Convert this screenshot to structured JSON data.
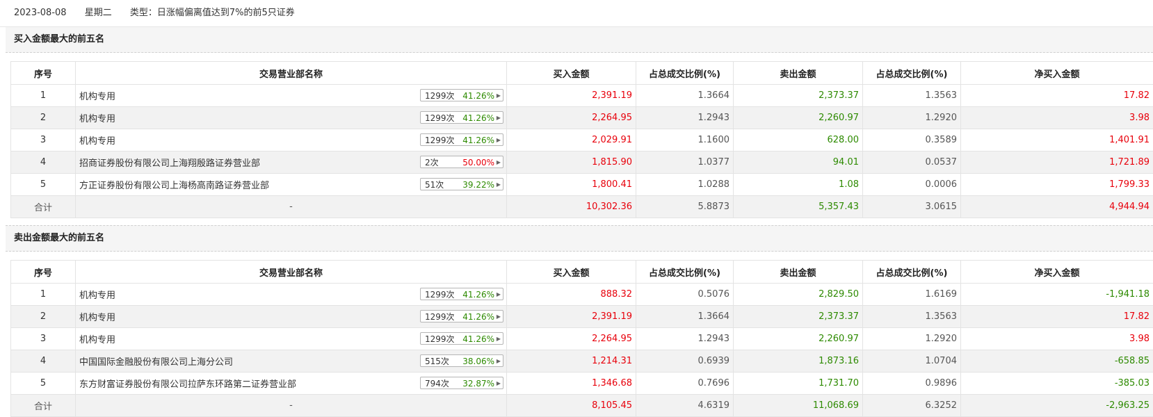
{
  "info": {
    "date": "2023-08-08",
    "weekday": "星期二",
    "type": "类型：日涨幅偏离值达到7%的前5只证券"
  },
  "colors": {
    "red": "#e8000b",
    "green": "#2d8a00"
  },
  "headers": [
    "序号",
    "交易营业部名称",
    "买入金额",
    "占总成交比例(%)",
    "卖出金额",
    "占总成交比例(%)",
    "净买入金额"
  ],
  "buy_section": {
    "title": "买入金额最大的前五名",
    "rows": [
      {
        "idx": "1",
        "name": "机构专用",
        "count": "1299次",
        "pct": "41.26%",
        "pct_color": "green",
        "buy": "2,391.19",
        "buy_ratio": "1.3664",
        "sell": "2,373.37",
        "sell_ratio": "1.3563",
        "net": "17.82",
        "net_color": "red"
      },
      {
        "idx": "2",
        "name": "机构专用",
        "count": "1299次",
        "pct": "41.26%",
        "pct_color": "green",
        "buy": "2,264.95",
        "buy_ratio": "1.2943",
        "sell": "2,260.97",
        "sell_ratio": "1.2920",
        "net": "3.98",
        "net_color": "red"
      },
      {
        "idx": "3",
        "name": "机构专用",
        "count": "1299次",
        "pct": "41.26%",
        "pct_color": "green",
        "buy": "2,029.91",
        "buy_ratio": "1.1600",
        "sell": "628.00",
        "sell_ratio": "0.3589",
        "net": "1,401.91",
        "net_color": "red"
      },
      {
        "idx": "4",
        "name": "招商证券股份有限公司上海翔殷路证券营业部",
        "count": "2次",
        "pct": "50.00%",
        "pct_color": "red",
        "buy": "1,815.90",
        "buy_ratio": "1.0377",
        "sell": "94.01",
        "sell_ratio": "0.0537",
        "net": "1,721.89",
        "net_color": "red"
      },
      {
        "idx": "5",
        "name": "方正证券股份有限公司上海杨高南路证券营业部",
        "count": "51次",
        "pct": "39.22%",
        "pct_color": "green",
        "buy": "1,800.41",
        "buy_ratio": "1.0288",
        "sell": "1.08",
        "sell_ratio": "0.0006",
        "net": "1,799.33",
        "net_color": "red"
      }
    ],
    "total": {
      "label": "合计",
      "name": "-",
      "buy": "10,302.36",
      "buy_ratio": "5.8873",
      "sell": "5,357.43",
      "sell_ratio": "3.0615",
      "net": "4,944.94",
      "net_color": "red"
    }
  },
  "sell_section": {
    "title": "卖出金额最大的前五名",
    "rows": [
      {
        "idx": "1",
        "name": "机构专用",
        "count": "1299次",
        "pct": "41.26%",
        "pct_color": "green",
        "buy": "888.32",
        "buy_ratio": "0.5076",
        "sell": "2,829.50",
        "sell_ratio": "1.6169",
        "net": "-1,941.18",
        "net_color": "green"
      },
      {
        "idx": "2",
        "name": "机构专用",
        "count": "1299次",
        "pct": "41.26%",
        "pct_color": "green",
        "buy": "2,391.19",
        "buy_ratio": "1.3664",
        "sell": "2,373.37",
        "sell_ratio": "1.3563",
        "net": "17.82",
        "net_color": "red"
      },
      {
        "idx": "3",
        "name": "机构专用",
        "count": "1299次",
        "pct": "41.26%",
        "pct_color": "green",
        "buy": "2,264.95",
        "buy_ratio": "1.2943",
        "sell": "2,260.97",
        "sell_ratio": "1.2920",
        "net": "3.98",
        "net_color": "red"
      },
      {
        "idx": "4",
        "name": "中国国际金融股份有限公司上海分公司",
        "count": "515次",
        "pct": "38.06%",
        "pct_color": "green",
        "buy": "1,214.31",
        "buy_ratio": "0.6939",
        "sell": "1,873.16",
        "sell_ratio": "1.0704",
        "net": "-658.85",
        "net_color": "green"
      },
      {
        "idx": "5",
        "name": "东方财富证券股份有限公司拉萨东环路第二证券营业部",
        "count": "794次",
        "pct": "32.87%",
        "pct_color": "green",
        "buy": "1,346.68",
        "buy_ratio": "0.7696",
        "sell": "1,731.70",
        "sell_ratio": "0.9896",
        "net": "-385.03",
        "net_color": "green"
      }
    ],
    "total": {
      "label": "合计",
      "name": "-",
      "buy": "8,105.45",
      "buy_ratio": "4.6319",
      "sell": "11,068.69",
      "sell_ratio": "6.3252",
      "net": "-2,963.25",
      "net_color": "green"
    }
  }
}
